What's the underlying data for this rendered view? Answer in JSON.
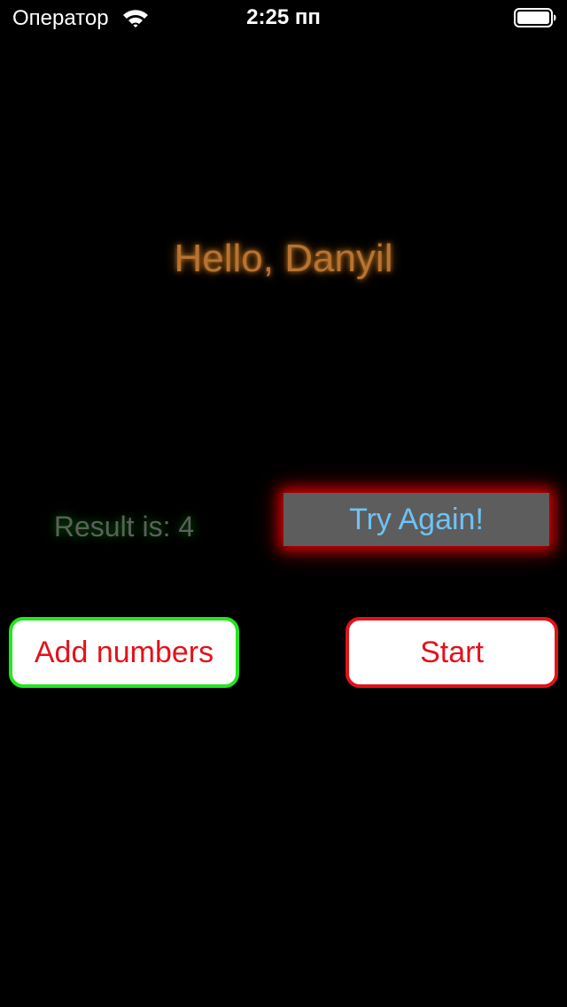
{
  "status_bar": {
    "carrier": "Оператор",
    "time": "2:25 пп",
    "wifi_icon": "wifi-icon",
    "battery_icon": "battery-icon"
  },
  "main": {
    "greeting": "Hello, Danyil",
    "result_text": "Result is: 4",
    "try_again_label": "Try Again!",
    "add_numbers_label": "Add numbers",
    "start_label": "Start"
  },
  "colors": {
    "background": "#000000",
    "greeting_text": "#b87330",
    "greeting_glow": "#e68c28",
    "result_text": "#5e5e5e",
    "result_glow": "#00a000",
    "try_again_bg": "#5d5d5d",
    "try_again_text": "#6ec3f5",
    "try_again_glow": "#e60000",
    "button_bg": "#ffffff",
    "button_text": "#e3121a",
    "add_numbers_border": "#22e61e",
    "start_border": "#e3121a"
  }
}
